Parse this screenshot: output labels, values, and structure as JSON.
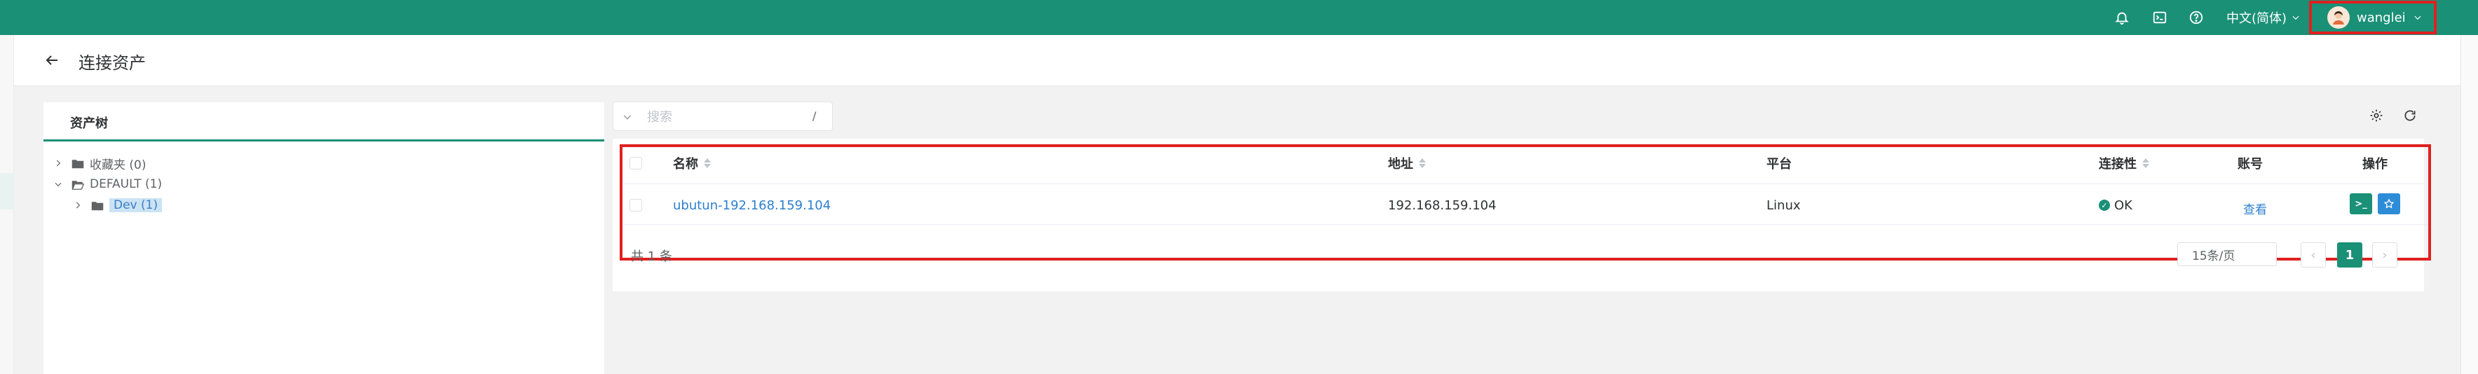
{
  "topbar": {
    "language": "中文(简体)",
    "username": "wanglei",
    "icons": [
      "bell-icon",
      "terminal-icon",
      "help-icon",
      "chevron-down-icon",
      "avatar"
    ],
    "accent_color": "#1a9077"
  },
  "page": {
    "title": "连接资产"
  },
  "tree": {
    "tab_label": "资产树",
    "nodes": [
      {
        "label": "收藏夹 (0)",
        "expanded": false,
        "level": 0
      },
      {
        "label": "DEFAULT (1)",
        "expanded": true,
        "level": 0
      },
      {
        "label": "Dev (1)",
        "expanded": false,
        "level": 1,
        "selected": true
      }
    ]
  },
  "search": {
    "placeholder": "搜索",
    "shortcut": "/"
  },
  "table": {
    "columns": [
      "名称",
      "地址",
      "平台",
      "连接性",
      "账号",
      "操作"
    ],
    "rows": [
      {
        "name": "ubutun-192.168.159.104",
        "address": "192.168.159.104",
        "platform": "Linux",
        "connectivity": "OK",
        "account": "查看",
        "actions": [
          "terminal-action-button",
          "favorite-action-button"
        ]
      }
    ]
  },
  "pagination": {
    "total": "共 1 条",
    "page_size": "15条/页",
    "current_page": "1",
    "prev": "‹",
    "next": "›"
  }
}
